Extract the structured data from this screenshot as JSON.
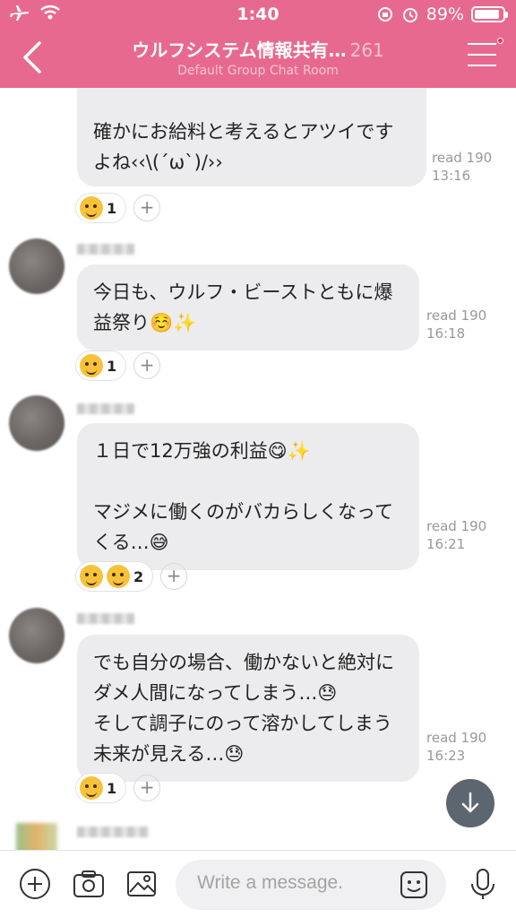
{
  "status": {
    "time": "1:40",
    "battery": "89%",
    "battery_level": 0.89
  },
  "header": {
    "title": "ウルフシステム情報共有…",
    "member_count": "261",
    "subtitle": "Default Group Chat Room"
  },
  "messages": [
    {
      "text_lines": [
        "確かにお給料と考えるとアツイです",
        "よね‹‹\\(´ω`)/››"
      ],
      "read": "read 190",
      "time": "13:16",
      "reaction_count": "1"
    },
    {
      "text_lines": [
        "今日も、ウルフ・ビーストともに爆",
        "益祭り☺️✨"
      ],
      "read": "read 190",
      "time": "16:18",
      "reaction_count": "1"
    },
    {
      "text_lines": [
        "１日で12万強の利益😋✨",
        "",
        "マジメに働くのがバカらしくなって",
        "くる…😅"
      ],
      "read": "read 190",
      "time": "16:21",
      "reaction_count": "2"
    },
    {
      "text_lines": [
        "でも自分の場合、働かないと絶対に",
        "ダメ人間になってしまう…😓",
        "そして調子にのって溶かしてしまう",
        "未来が見える…😓"
      ],
      "read": "read 190",
      "time": "16:23",
      "reaction_count": "1"
    }
  ],
  "input": {
    "placeholder": "Write a message."
  },
  "colors": {
    "header": "#e8698f",
    "bubble": "#ececee"
  }
}
